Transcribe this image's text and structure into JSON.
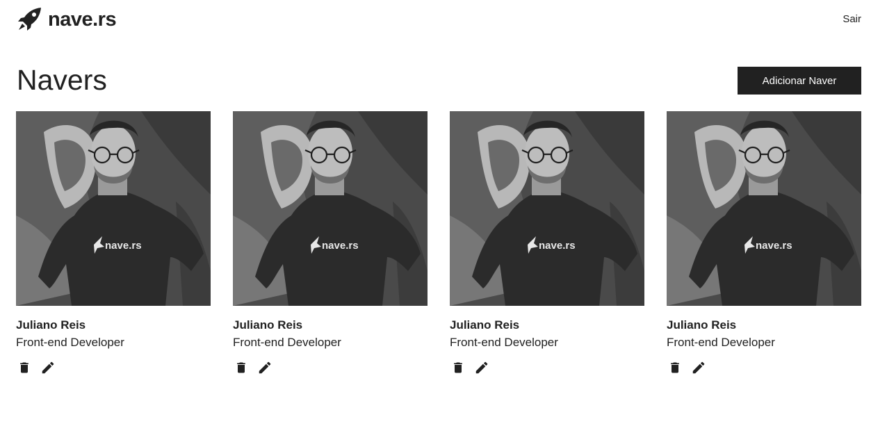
{
  "header": {
    "logo_text": "nave.rs",
    "logout_label": "Sair"
  },
  "main": {
    "title": "Navers",
    "add_button_label": "Adicionar Naver",
    "navers": [
      {
        "name": "Juliano Reis",
        "role": "Front-end Developer",
        "shirt_text": "nave.rs"
      },
      {
        "name": "Juliano Reis",
        "role": "Front-end Developer",
        "shirt_text": "nave.rs"
      },
      {
        "name": "Juliano Reis",
        "role": "Front-end Developer",
        "shirt_text": "nave.rs"
      },
      {
        "name": "Juliano Reis",
        "role": "Front-end Developer",
        "shirt_text": "nave.rs"
      }
    ],
    "card_icons": [
      "trash-icon",
      "pencil-icon"
    ]
  },
  "colors": {
    "text": "#212121",
    "button_bg": "#212121",
    "button_text": "#ffffff",
    "background": "#ffffff"
  }
}
